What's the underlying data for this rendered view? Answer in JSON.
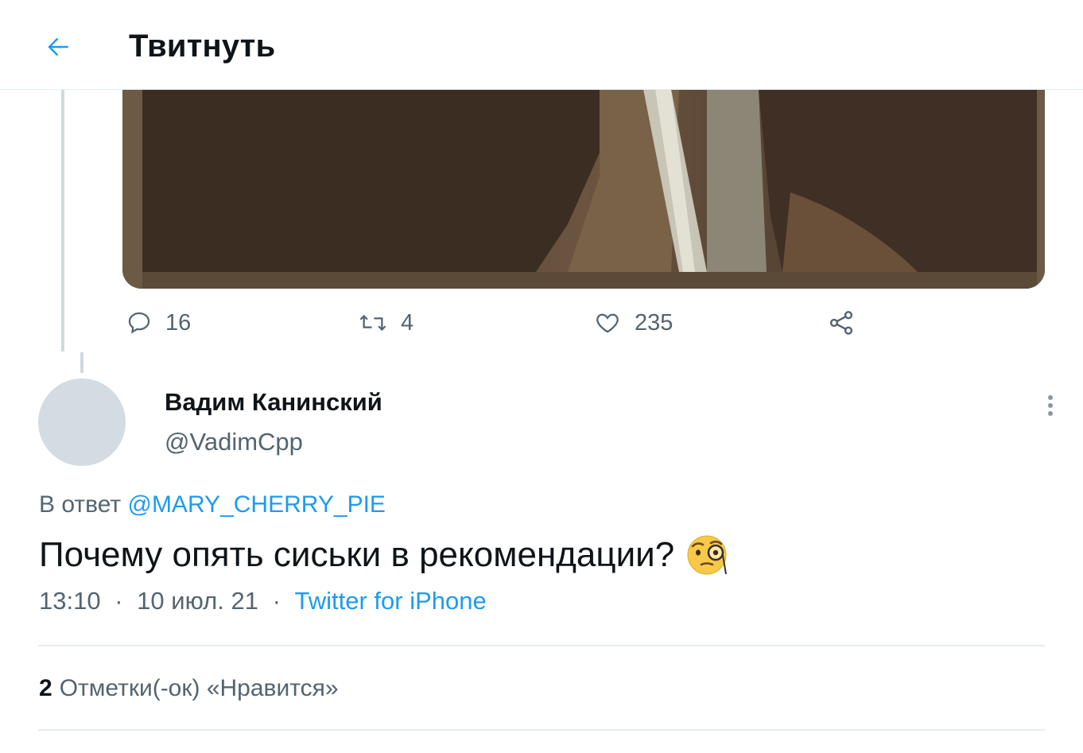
{
  "header": {
    "title": "Твитнуть",
    "back_icon": "arrow-left-icon",
    "accent_color": "#1d9bf0"
  },
  "previous_tweet": {
    "media_icon": "photo-media",
    "actions": {
      "reply_count": "16",
      "retweet_count": "4",
      "like_count": "235",
      "icons": [
        "reply-icon",
        "retweet-icon",
        "heart-icon",
        "share-icon"
      ]
    }
  },
  "tweet": {
    "author_name": "Вадим Канинский",
    "author_handle": "@VadimCpp",
    "reply_prefix": "В ответ",
    "reply_mention": "@MARY_CHERRY_PIE",
    "text": "Почему опять сиськи в рекомендации?",
    "emoji": "face-with-monocle-icon",
    "time": "13:10",
    "date": "10 июл. 21",
    "separator": "·",
    "source": "Twitter for iPhone"
  },
  "likes_summary": {
    "count": "2",
    "label": "Отметки(-ок) «Нравится»"
  }
}
